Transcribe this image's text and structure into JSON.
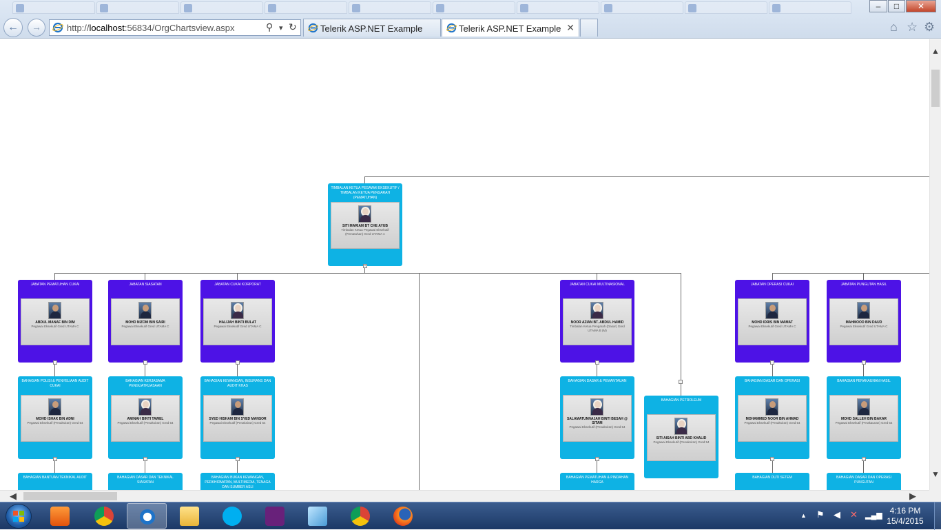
{
  "browser": {
    "url_prefix": "http://",
    "url_host": "localhost",
    "url_rest": ":56834/OrgChartsview.aspx",
    "tabs": [
      {
        "label": "Telerik ASP.NET Example"
      },
      {
        "label": "Telerik ASP.NET Example"
      }
    ],
    "buttons": {
      "back": "←",
      "forward": "→",
      "search": "⚲",
      "dropdown": "▾",
      "refresh": "↻",
      "close_tab": "✕",
      "minimize": "–",
      "maximize": "□",
      "close": "✕",
      "home": "⌂",
      "favorites": "☆",
      "tools": "⚙"
    }
  },
  "org": {
    "root": {
      "title": "TIMBALAN KETUA PEGAWAI EKSEKUTIF / TIMBALAN KETUA PENGARAH (PEMATUHAN)",
      "name": "SITI MARIAM BT CHE AYUB",
      "grade": "Timbalan Ketua Pegawai Eksekutif (Pematuhan) Gred UTAMA A"
    },
    "level1": [
      {
        "title": "JABATAN PEMATUHAN CUKAI",
        "name": "ABDUL MANAF BIN DIM",
        "grade": "Pegawai Eksekutif Gred UTAMA C"
      },
      {
        "title": "JABATAN SIASATAN",
        "name": "MOHD NIZOM BIN SAIRI",
        "grade": "Pegawai Eksekutif Gred UTAMA C"
      },
      {
        "title": "JABATAN CUKAI KORPORAT",
        "name": "HALIJAH BINTI BULAT",
        "grade": "Pegawai Eksekutif Gred UTAMA C"
      },
      {
        "title": "JABATAN CUKAI MULTINASIONAL",
        "name": "NOOR AZIAN BT. ABDUL HAMID",
        "grade": "Timbalan Ketua Pengarah (Dasar) Gred UTAMA B (M)"
      },
      {
        "title": "JABATAN OPERASI CUKAI",
        "name": "MOHD IDRIS BIN MAMAT",
        "grade": "Pegawai Eksekutif Gred UTAMA C"
      },
      {
        "title": "JABATAN PUNGUTAN HASIL",
        "name": "MAHMOOD BIN DAUD",
        "grade": "Pegawai Eksekutif Gred UTAMA C"
      }
    ],
    "level2": [
      {
        "title": "BAHAGIAN POLISI & PENYELIAAN AUDIT CUKAI",
        "name": "MOHD ISHAK BIN ADNI",
        "grade": "Pegawai Eksekutif (Penaksiran) Gred 54"
      },
      {
        "title": "BAHAGIAN KERJASAMA PENGUATKUASAAN",
        "name": "AMINAH BINTI TAWEL",
        "grade": "Pegawai Eksekutif (Penaksiran) Gred 54"
      },
      {
        "title": "BAHAGIAN KEWANGAN, INSURANS DAN AUDIT KHAS",
        "name": "SYED HISHAM BIN SYED MANSOR",
        "grade": "Pegawai Eksekutif (Penaksiran) Gred 54"
      },
      {
        "title": "BAHAGIAN DASAR & PEMANTAUAN",
        "name": "SALAMATUNNAJAH BINTI BESAH @ SITAM",
        "grade": "Pegawai Eksekutif (Penaksiran) Gred 54"
      },
      {
        "title": "BAHAGIAN PETROLEUM",
        "name": "SITI AISAH BINTI ABD KHALID",
        "grade": "Pegawai Eksekutif (Penaksiran) Gred 54"
      },
      {
        "title": "BAHAGIAN DASAR DAN OPERASI",
        "name": "MOHAMMED NOOR BIN AHMAD",
        "grade": "Pegawai Eksekutif (Penaksiran) Gred 54"
      },
      {
        "title": "BAHAGIAN PERAKAUNAN HASIL",
        "name": "MOHD SALLEH BIN BAKAR",
        "grade": "Pegawai Eksekutif (Perakaunan) Gred 54"
      }
    ],
    "level3": [
      {
        "title": "BAHAGIAN BANTUAN TEKNIKAL AUDIT"
      },
      {
        "title": "BAHAGIAN DASAR DAN TEKNIKAL SIASATAN"
      },
      {
        "title": "BAHAGIAN BUKAN KEWANGAN, PERKHIDMATAN, MULTIMEDIA, TENAGA DAN SUMBER ASLI"
      },
      {
        "title": "BAHAGIAN PEMATUHAN & PINDAHAN HARGA"
      },
      {
        "title": "BAHAGIAN DUTI SETEM"
      },
      {
        "title": "BAHAGIAN DASAR DAN OPERASI PUNGUTAN"
      }
    ],
    "toggle_symbol": "−"
  },
  "taskbar": {
    "time": "4:16 PM",
    "date": "15/4/2015",
    "tray_expand": "▲"
  }
}
